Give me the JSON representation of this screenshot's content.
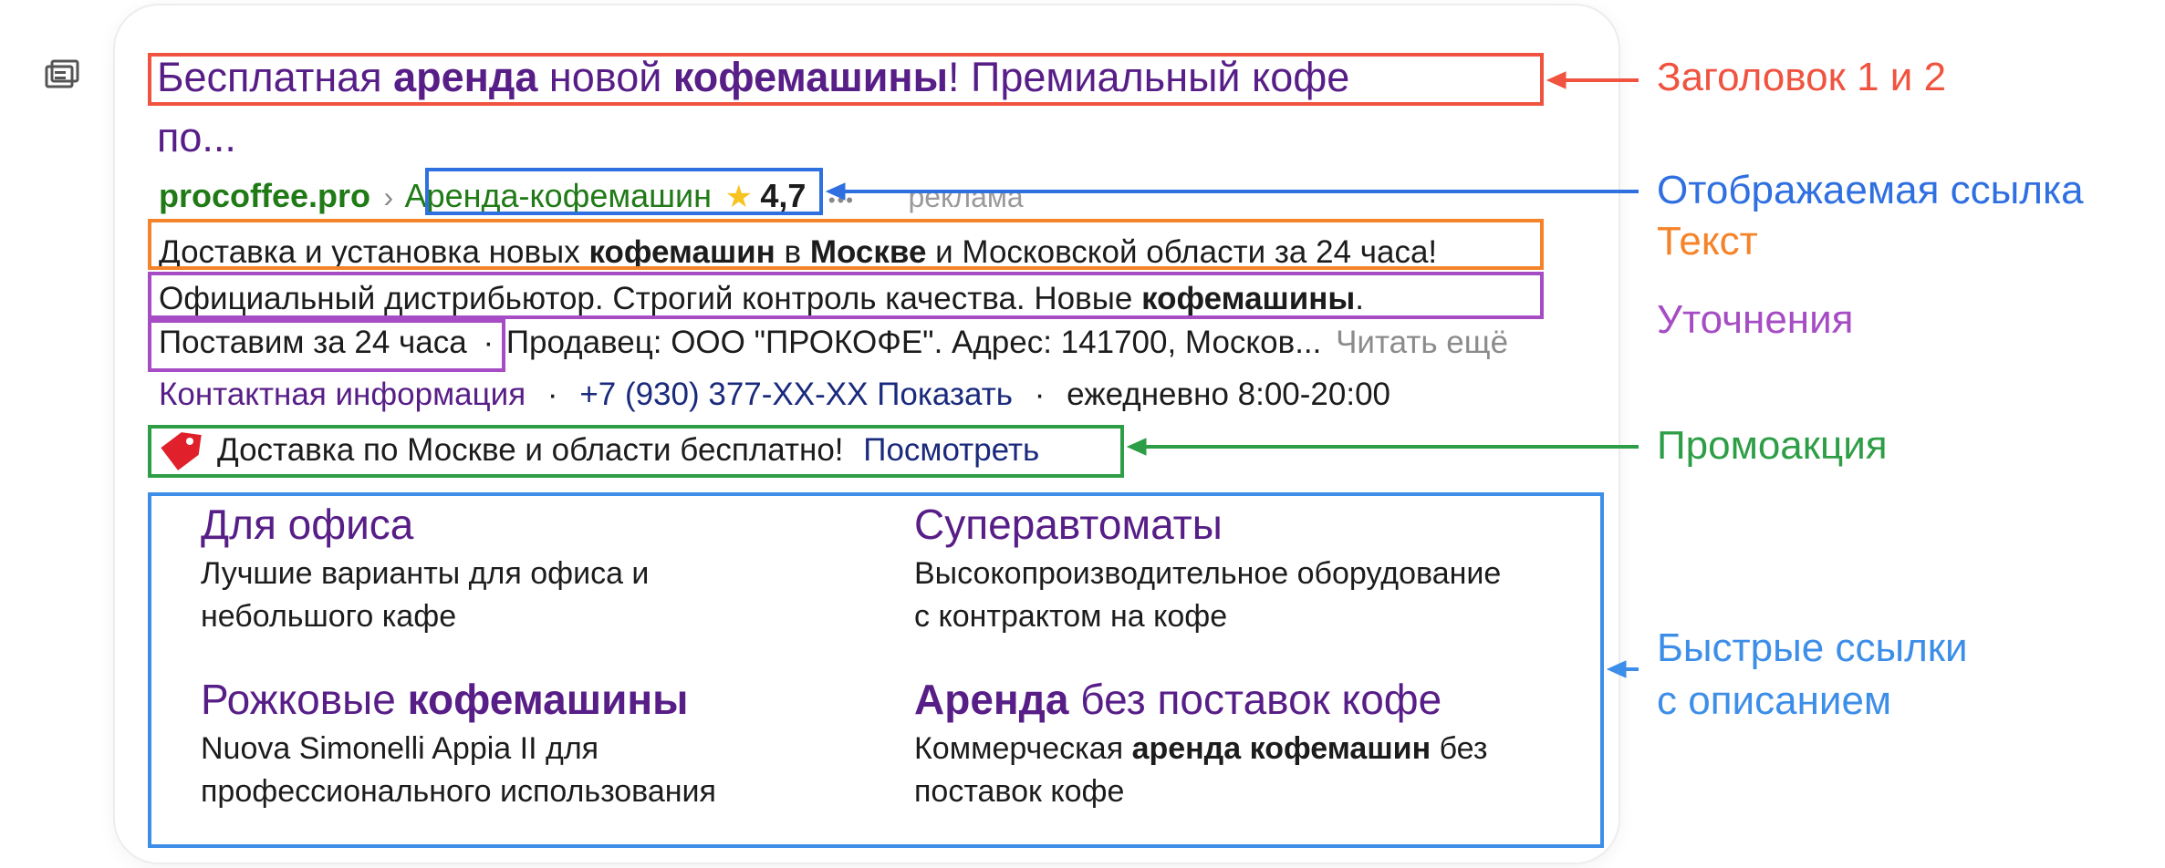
{
  "colors": {
    "title": "#581e87",
    "domain_green": "#207a16",
    "annotation_red": "#f0533f",
    "annotation_blue": "#2f6fe0",
    "annotation_orange": "#f5832a",
    "annotation_purple": "#a64cc4",
    "annotation_green": "#2e9e46",
    "annotation_lightblue": "#3d8ee8"
  },
  "ad": {
    "icon": "ad-badge-icon",
    "title": {
      "p1": "Бесплатная ",
      "b1": "аренда",
      "p2": " новой ",
      "b2": "кофемашины",
      "p3": "! Премиальный кофе",
      "line2": "по..."
    },
    "url": {
      "domain": "procoffee.pro",
      "separator": "›",
      "path": "Аренда-кофемашин",
      "star": "★",
      "rating": "4,7",
      "dots": "•••",
      "ad_label": "реклама"
    },
    "text": {
      "p1": "Доставка и установка новых ",
      "b1": "кофемашин",
      "p2": " в ",
      "b2": "Москве",
      "p3": " и Московской области за 24 часа!"
    },
    "callouts": {
      "line1_text": "Официальный дистрибьютор. Строгий контроль качества. Новые ",
      "line1_bold": "кофемашины",
      "line1_end": ".",
      "line2_item": "Поставим за 24 часа",
      "line2_dot": "·",
      "line2_rest": "Продавец: ООО \"ПРОКОФЕ\". Адрес: 141700, Москов...",
      "read_more": "Читать ещё"
    },
    "contacts": {
      "label": "Контактная информация",
      "dot": "·",
      "phone": "+7 (930) 377-XX-XX",
      "show": "Показать",
      "hours": "ежедневно 8:00-20:00"
    },
    "promo": {
      "icon": "price-tag-icon",
      "text": "Доставка по Москве и области бесплатно!",
      "link": "Посмотреть"
    },
    "sitelinks": [
      {
        "title_plain": "Для офиса",
        "desc_line1": "Лучшие варианты для офиса и",
        "desc_line2": "небольшого кафе"
      },
      {
        "title_plain": "Суперавтоматы",
        "desc_line1": "Высокопроизводительное оборудование",
        "desc_line2": "с контрактом на кофе"
      },
      {
        "title_plain": "Рожковые ",
        "title_bold": "кофемашины",
        "desc_line1": "Nuova Simonelli Appia II для",
        "desc_line2": "профессионального использования"
      },
      {
        "title_bold": "Аренда",
        "title_plain": " без поставок кофе",
        "desc_p1": "Коммерческая ",
        "desc_b1": "аренда кофемашин",
        "desc_p2": " без",
        "desc_line2": "поставок кофе"
      }
    ]
  },
  "annotations": {
    "headline": "Заголовок 1 и 2",
    "display_url": "Отображаемая ссылка",
    "text": "Текст",
    "callouts": "Уточнения",
    "promo": "Промоакция",
    "sitelinks_line1": "Быстрые ссылки",
    "sitelinks_line2": "с описанием"
  }
}
